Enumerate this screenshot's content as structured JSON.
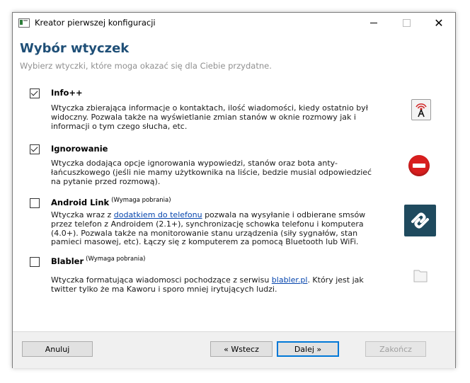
{
  "window": {
    "title": "Kreator pierwszej konfiguracji",
    "close_glyph": "✕"
  },
  "header": {
    "title": "Wybór wtyczek",
    "subtitle": "Wybierz wtyczki, które moga okazać się dla Ciebie przydatne."
  },
  "plugins": [
    {
      "name": "Info++",
      "checked": true,
      "requires_download": "",
      "description": "Wtyczka zbierająca informacje o kontaktach, ilość wiadomości, kiedy ostatnio był widoczny. Pozwala także na wyświetlanie zmian stanów w oknie rozmowy jak i informacji o tym czego słucha, etc.",
      "icon": "radio-tower-icon"
    },
    {
      "name": "Ignorowanie",
      "checked": true,
      "requires_download": "",
      "description": "Wtyczka dodająca opcje ignorowania wypowiedzi, stanów oraz bota anty-łańcuszkowego (jeśli nie mamy użytkownika na liście, bedzie musial odpowiedzieć na pytanie przed rozmową).",
      "icon": "stop-sign-icon"
    },
    {
      "name": "Android Link",
      "checked": false,
      "requires_download": "(Wymaga pobrania)",
      "description_before_link": "Wtyczka wraz z ",
      "link_text": "dodatkiem do telefonu",
      "description_after_link": " pozwala na wysyłanie i odbierane smsów przez telefon z Androidem (2.1+), synchronizację schowka telefonu i komputera (4.0+). Pozwala także na monitorowanie stanu urządzenia (siły sygnałów, stan pamieci masowej, etc). Łączy się z komputerem za pomocą Bluetooth lub WiFi.",
      "icon": "android-link-icon"
    },
    {
      "name": "Blabler",
      "checked": false,
      "requires_download": "(Wymaga pobrania)",
      "description_before_link": "Wtyczka formatująca wiadomosci pochodzące z serwisu ",
      "link_text": "blabler.pl",
      "description_after_link": ". Który jest jak twitter tylko że ma Kaworu i sporo mniej irytujących ludzi.",
      "icon": "blank-file-icon"
    }
  ],
  "buttons": {
    "cancel": "Anuluj",
    "back": "« Wstecz",
    "next": "Dalej »",
    "finish": "Zakończ"
  },
  "colors": {
    "heading": "#1f4f77",
    "link": "#0645ad",
    "stop_red": "#d81e1e",
    "android_bg": "#1f4a5e",
    "default_button_border": "#0078d7"
  }
}
